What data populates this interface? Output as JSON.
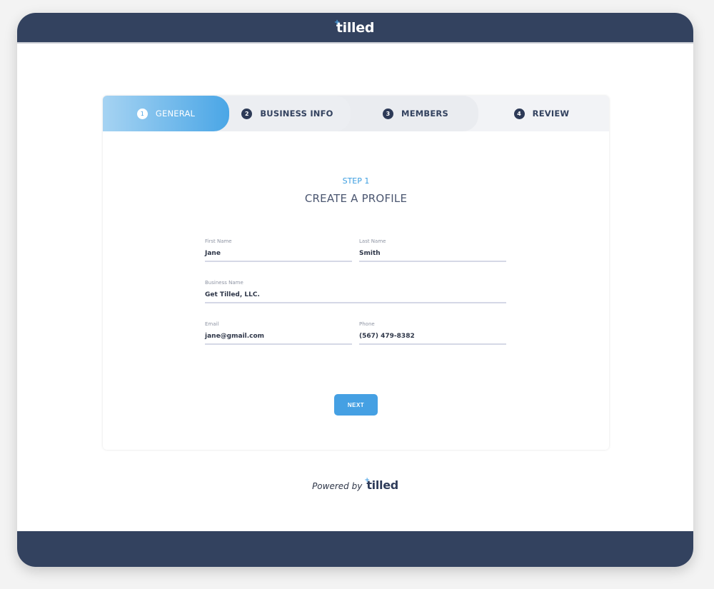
{
  "header": {
    "logo_text": "tilled",
    "logo_plus": "+"
  },
  "colors": {
    "navy": "#33425f",
    "accent": "#45a0e3"
  },
  "steps": [
    {
      "number": "1",
      "label": "GENERAL",
      "active": true
    },
    {
      "number": "2",
      "label": "BUSINESS INFO",
      "active": false
    },
    {
      "number": "3",
      "label": "MEMBERS",
      "active": false
    },
    {
      "number": "4",
      "label": "REVIEW",
      "active": false
    }
  ],
  "form": {
    "step_label": "STEP 1",
    "title": "CREATE A PROFILE",
    "fields": {
      "first_name": {
        "label": "First Name",
        "value": "Jane"
      },
      "last_name": {
        "label": "Last Name",
        "value": "Smith"
      },
      "business_name": {
        "label": "Business Name",
        "value": "Get Tilled, LLC."
      },
      "email": {
        "label": "Email",
        "value": "jane@gmail.com"
      },
      "phone": {
        "label": "Phone",
        "value": "(567) 479-8382"
      }
    },
    "next_label": "NEXT"
  },
  "footer": {
    "powered_by": "Powered by",
    "logo_text": "tilled",
    "logo_plus": "+"
  }
}
